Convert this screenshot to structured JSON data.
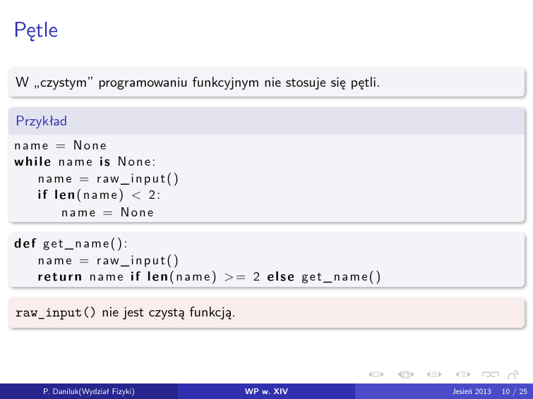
{
  "title": "Pętle",
  "block1": {
    "text": "W „czystym” programowaniu funkcyjnym nie stosuje się pętli."
  },
  "example": {
    "header": "Przykład",
    "l1a": "name = None",
    "l2a": "while",
    "l2b": " name ",
    "l2c": "is",
    "l2d": " None:",
    "l3a": "    name = raw_input()",
    "l4a": "    ",
    "l4b": "if",
    "l4c": " ",
    "l4d": "len",
    "l4e": "(name) < 2:",
    "l5a": "        name = None"
  },
  "func": {
    "l1a": "def",
    "l1b": " get_name():",
    "l2a": "    name = raw_input()",
    "l3a": "    ",
    "l3b": "return",
    "l3c": " name ",
    "l3d": "if",
    "l3e": " ",
    "l3f": "len",
    "l3g": "(name) >= 2 ",
    "l3h": "else",
    "l3i": " get_name()"
  },
  "note": {
    "tt": "raw_input()",
    "rest": " nie jest czystą funkcją."
  },
  "foot": {
    "author": "P. Daniluk(Wydział Fizyki)",
    "center": "WP w. XIV",
    "date": "Jesień 2013",
    "page": "10 / 25"
  }
}
